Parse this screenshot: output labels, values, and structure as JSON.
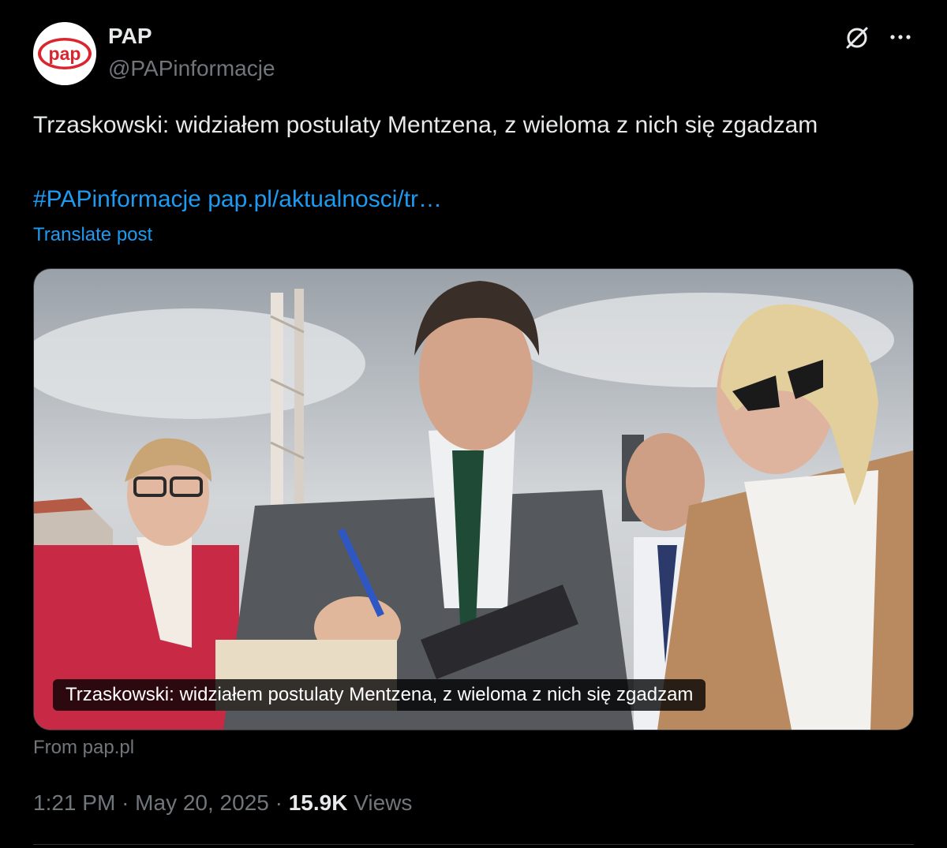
{
  "author": {
    "name": "PAP",
    "handle": "@PAPinformacje",
    "avatar_text": "pap"
  },
  "post": {
    "text": "Trzaskowski: widziałem postulaty Mentzena, z wieloma z nich się zgadzam",
    "hashtag": "#PAPinformacje",
    "link": "pap.pl/aktualnosci/tr…",
    "translate_label": "Translate post"
  },
  "card": {
    "caption": "Trzaskowski: widziałem postulaty Mentzena, z wieloma z nich się zgadzam",
    "source": "From pap.pl"
  },
  "meta": {
    "time": "1:21 PM",
    "separator": "·",
    "date": "May 20, 2025",
    "views_count": "15.9K",
    "views_label": "Views"
  },
  "icons": {
    "grok": "grok-icon",
    "more": "more-icon"
  },
  "colors": {
    "background": "#000000",
    "text_primary": "#e7e9ea",
    "text_secondary": "#71767b",
    "link": "#1d9bf0",
    "brand_red": "#d9262e"
  }
}
